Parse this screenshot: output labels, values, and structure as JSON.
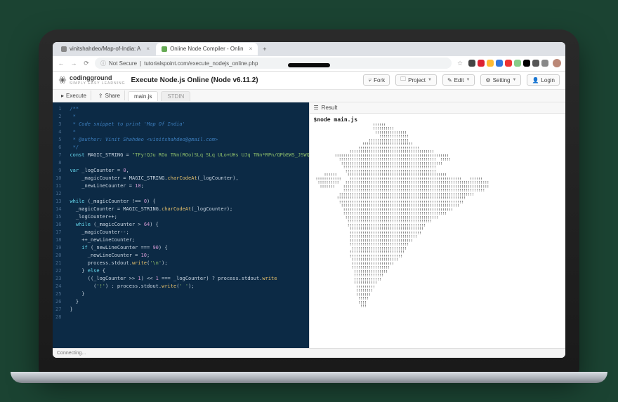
{
  "browser": {
    "tabs": [
      {
        "label": "vinitshahdeo/Map-of-India: A"
      },
      {
        "label": "Online Node Compiler - Onlin"
      }
    ],
    "new_tab": "+",
    "nav": {
      "back": "←",
      "forward": "→",
      "reload": "⟳"
    },
    "security_label": "Not Secure",
    "url": "tutorialspoint.com/execute_nodejs_online.php",
    "star": "☆",
    "ext_colors": [
      "#444",
      "#d23",
      "#fb3",
      "#37d",
      "#e33",
      "#8c8",
      "#000",
      "#555",
      "#888"
    ]
  },
  "site": {
    "brand": "codingground",
    "brand_sub": "SIMPLY EASY LEARNING",
    "title": "Execute Node.js Online (Node v6.11.2)",
    "buttons": {
      "fork": "Fork",
      "project": "Project",
      "edit": "Edit",
      "setting": "Setting",
      "login": "Login"
    }
  },
  "toolbar": {
    "execute": "Execute",
    "share": "Share",
    "file_main": "main.js",
    "file_stdin": "STDIN"
  },
  "code": {
    "lines": [
      "/**",
      " *",
      " * Code snippet to print 'Map Of India'",
      " *",
      " * @author: Vinit Shahdeo <vinitshahdeo@gmail.com>",
      " */",
      "const MAGIC_STRING = \"TFy!QJu ROo TNn(ROo)SLq SLq ULo+UHs UJq TNn*RPn/QPbEWS_JSWQAIJO^NBELPeHBFHT]TnALVlBLOFAkHFOuFETpHCStHAUFAgcEAelclcn^r^r\\\\tZvYxXyT|S~Pn SPm SOn TNn ULo0ULo#ULo-WHq!WFs XDt!\";",
      "",
      "var _logCounter = 0,",
      "    _magicCounter = MAGIC_STRING.charCodeAt(_logCounter),",
      "    _newLineCounter = 10;",
      "",
      "while (_magicCounter !== 0) {",
      "  _magicCounter = MAGIC_STRING.charCodeAt(_logCounter);",
      "  _logCounter++;",
      "  while (_magicCounter > 64) {",
      "    _magicCounter--;",
      "    ++_newLineCounter;",
      "    if (_newLineCounter === 90) {",
      "      _newLineCounter = 10;",
      "      process.stdout.write('\\n');",
      "    } else {",
      "      ((_logCounter >> 1) << 1 === _logCounter) ? process.stdout.write",
      "        ('!') : process.stdout.write(' ');",
      "    }",
      "  }",
      "}",
      ""
    ]
  },
  "result": {
    "header": "Result",
    "command": "$node main.js",
    "ascii": "                            !!!!!!\n                            !!!!!!!!!!\n                             !!!!!!!!!!!!!!!\n                               !!!!!!!!!!!!!!\n                          !!!!!!!!!!!!!!!!!!!\n                       !!!!!!!!!!!!!!!!!!!!!!!!\n                     !!!!!!!!!!!!!!!!!!!!!!!!!!!!!\n                 !!!!!!!!!!!!!!!!!!!!!!!!!!!!!!!!!!!!!!!!\n          !!!!!!!!!!!!!!!!!!!!!!!!!!!!!!!!!!!!!!!!!!!!!!!!!!!!!!\n            !!!!!!!!!!!!!!!!!!!!!!!!!!!!!!!!!!!!!!!!!!!!!!  !!!!!\n             !!!!!!!!!!!!!!!!!!!!!!!!!!!!!!!!!!!!!!!!!!!!!!!!\n              !!!!!!!!!!!!!!!!!!!!!!!!!!!!!!!!!!!!!!!!!!!!\n               !!!!!!!!!!!!!!!!!!!!!!!!!!!!!!!!!!!!!!!!!!!\n     !!!!!!     !!!!!!!!!!!!!!!!!!!!!!!!!!!!!!!!!!!!!!!!!!!!!!!\n !!!!!!!!!!!!    !!!!!!!!!!!!!!!!!!!!!!!!!!!!!!!!!!!!!!!!!!!!!!!!!!!!!    !!!!!!\n  !!!!!!!!!!   !!!!!!!!!!!!!!!!!!!!!!!!!!!!!!!!!!!!!!!!!!!!!!!!!!!!!!!!!!!!!!!!!!!!\n   !!!!!!!    !!!!!!!!!!!!!!!!!!!!!!!!!!!!!!!!!!!!!!!!!!!!!!!!!!!!!!!!!!!!!!!!!!!!!\n              !!!!!!!!!!!!!!!!!!!!!!!!!!!!!!!!!!!!!!!!!!!!!!!!!!!!!!!!!!!!!!!!!!!\n            !!!!!!!!!!!!!!!!!!!!!!!!!!!!!!!!!!!!!!!!!!!!!!!!!!!!!!!!!!!!!!!!\n           !!!!!!!!!!!!!!!!!!!!!!!!!!!!!!!!!!!!!!!!!!!!!!!!!!!!!!!!!!!!!\n            !!!!!!!!!!!!!!!!!!!!!!!!!!!!!!!!!!!!!!!!!!!!!!!!!!!!!!!!!!!\n             !!!!!!!!!!!!!!!!!!!!!!!!!!!!!!!!!!!!!!!!!!!!!!!!!!!!!!!!\n              !!!!!!!!!!!!!!!!!!!!!!!!!!!!!!!!!!!!!!!!!!!!!!!!!!!!\n              !!!!!!!!!!!!!!!!!!!!!!!!!!!!!!!!!!!!!!!!!!!!!!!!!\n               !!!!!!!!!!!!!!!!!!!!!!!!!!!!!!!!!!!!!!!!!!!!\n                !!!!!!!!!!!!!!!!!!!!!!!!!!!!!!!!!!!!!!!!\n                !!!!!!!!!!!!!!!!!!!!!!!!!!!!!!!!!!!!!\n                 !!!!!!!!!!!!!!!!!!!!!!!!!!!!!!!!!!!\n                 !!!!!!!!!!!!!!!!!!!!!!!!!!!!!!!!!!\n                 !!!!!!!!!!!!!!!!!!!!!!!!!!!!!!!!\n                 !!!!!!!!!!!!!!!!!!!!!!!!!!!!!!\n                 !!!!!!!!!!!!!!!!!!!!!!!!!!!!\n                  !!!!!!!!!!!!!!!!!!!!!!!!!!\n                 !!!!!!!!!!!!!!!!!!!!!!!!!!\n                 !!!!!!!!!!!!!!!!!!!!!!!!!\n                  !!!!!!!!!!!!!!!!!!!!!!\n                  !!!!!!!!!!!!!!!!!!!!\n                  !!!!!!!!!!!!!!!!!!\n                   !!!!!!!!!!!!!!!!\n                   !!!!!!!!!!!!!!\n                   !!!!!!!!!!!!!\n                   !!!!!!!!!!!\n                    !!!!!!!!!\n                    !!!!!!!!\n                    !!!!!!!\n                     !!!!!\n                     !!!!\n                      !!!"
  },
  "status": "Connecting..."
}
